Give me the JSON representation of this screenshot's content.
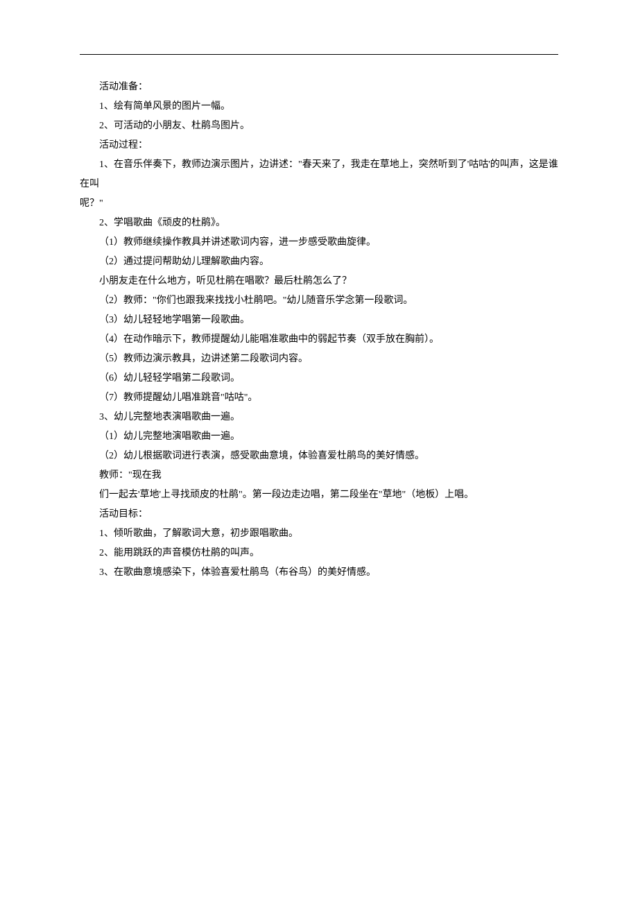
{
  "lines": [
    {
      "text": "活动准备：",
      "indent": true
    },
    {
      "text": "1、绘有简单风景的图片一幅。",
      "indent": true
    },
    {
      "text": "2、可活动的小朋友、杜鹃鸟图片。",
      "indent": true
    },
    {
      "text": "活动过程：",
      "indent": true
    },
    {
      "text": "1、在音乐伴奏下，教师边演示图片，边讲述：\"春天来了，我走在草地上，突然听到了'咕咕'的叫声，这是谁在叫",
      "indent": true
    },
    {
      "text": "呢？\"",
      "indent": false
    },
    {
      "text": "2、学唱歌曲《顽皮的杜鹃》。",
      "indent": true
    },
    {
      "text": "（1）教师继续操作教具并讲述歌词内容，进一步感受歌曲旋律。",
      "indent": true
    },
    {
      "text": "（2）通过提问帮助幼儿理解歌曲内容。",
      "indent": true
    },
    {
      "text": "小朋友走在什么地方，听见杜鹃在唱歌？最后杜鹃怎么了？",
      "indent": true
    },
    {
      "text": "（2）教师：\"你们也跟我来找找小杜鹃吧。\"幼儿随音乐学念第一段歌词。",
      "indent": true
    },
    {
      "text": "（3）幼儿轻轻地学唱第一段歌曲。",
      "indent": true
    },
    {
      "text": "（4）在动作暗示下，教师提醒幼儿能唱准歌曲中的弱起节奏（双手放在胸前）。",
      "indent": true
    },
    {
      "text": "（5）教师边演示教具，边讲述第二段歌词内容。",
      "indent": true
    },
    {
      "text": "（6）幼儿轻轻学唱第二段歌词。",
      "indent": true
    },
    {
      "text": "（7）教师提醒幼儿唱准跳音\"咕咕\"。",
      "indent": true
    },
    {
      "text": "3、幼儿完整地表演唱歌曲一遍。",
      "indent": true
    },
    {
      "text": "（1）幼儿完整地演唱歌曲一遍。",
      "indent": true
    },
    {
      "text": "（2）幼儿根据歌词进行表演，感受歌曲意境，体验喜爱杜鹃鸟的美好情感。",
      "indent": true
    },
    {
      "text": "教师：\"现在我",
      "indent": true
    },
    {
      "text": "们一起去'草地'上寻找顽皮的杜鹃\"。第一段边走边唱，第二段坐在\"草地\"（地板）上唱。",
      "indent": true
    },
    {
      "text": "活动目标：",
      "indent": true
    },
    {
      "text": "1、倾听歌曲，了解歌词大意，初步跟唱歌曲。",
      "indent": true
    },
    {
      "text": "2、能用跳跃的声音模仿杜鹃的叫声。",
      "indent": true
    },
    {
      "text": "3、在歌曲意境感染下，体验喜爱杜鹃鸟（布谷鸟）的美好情感。",
      "indent": true
    }
  ]
}
